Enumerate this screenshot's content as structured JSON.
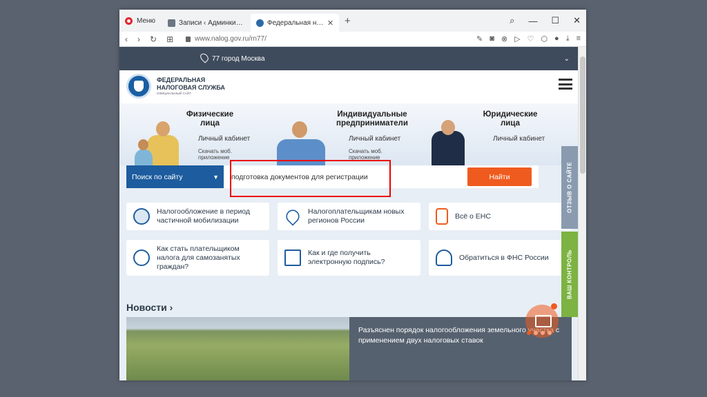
{
  "browser": {
    "menu_label": "Меню",
    "tabs": [
      {
        "title": "Записи ‹ Админкин — Wo"
      },
      {
        "title": "Федеральная налоговая с"
      }
    ],
    "url": "www.nalog.gov.ru/rn77/"
  },
  "site": {
    "region": "77 город Москва",
    "logo_line1": "ФЕДЕРАЛЬНАЯ",
    "logo_line2": "НАЛОГОВАЯ СЛУЖБА",
    "logo_sub": "ОФИЦИАЛЬНЫЙ САЙТ",
    "categories": [
      {
        "title": "Физические лица",
        "cabinet": "Личный кабинет",
        "app": "Скачать моб. приложение"
      },
      {
        "title": "Индивидуальные предприниматели",
        "cabinet": "Личный кабинет",
        "app": "Скачать моб. приложение"
      },
      {
        "title": "Юридические лица",
        "cabinet": "Личный кабинет"
      }
    ],
    "search": {
      "scope_label": "Поиск по сайту",
      "query": "подготовка документов для регистрации",
      "button": "Найти"
    },
    "cards": [
      {
        "text": "Налогообложение в период частичной мобилизации",
        "icon": "emblem-icon"
      },
      {
        "text": "Налогоплательщикам новых регионов России",
        "icon": "map-pin-flag-icon"
      },
      {
        "text": "Всё о ЕНС",
        "icon": "phone-ruble-icon"
      },
      {
        "text": "Как стать плательщиком налога для самозанятых граждан?",
        "icon": "person-ruble-icon"
      },
      {
        "text": "Как и где получить электронную подпись?",
        "icon": "signature-doc-icon"
      },
      {
        "text": "Обратиться в ФНС России",
        "icon": "question-person-icon"
      }
    ],
    "side_tabs": [
      {
        "label": "ОТЗЫВ О САЙТЕ",
        "color": "#8a9bb0"
      },
      {
        "label": "ВАШ КОНТРОЛЬ",
        "color": "#7cb342"
      }
    ],
    "news": {
      "heading": "Новости ›",
      "item_text": "Разъяснен порядок налогообложения земельного участка с применением двух налоговых ставок"
    },
    "accent": "#ef5b1e",
    "primary": "#1d5c9e"
  }
}
